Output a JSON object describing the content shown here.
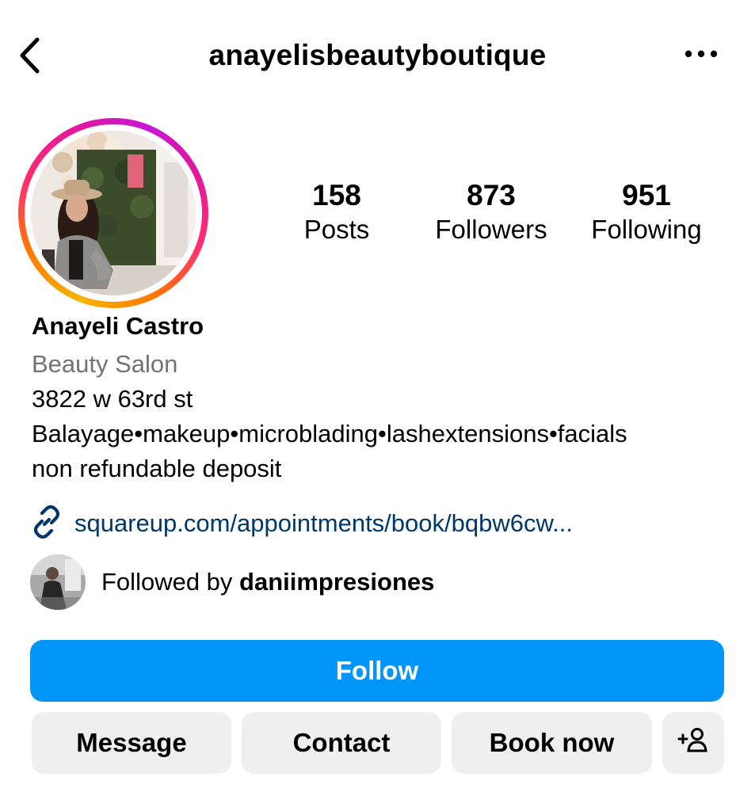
{
  "header": {
    "username": "anayelisbeautyboutique"
  },
  "stats": {
    "posts": {
      "count": "158",
      "label": "Posts"
    },
    "followers": {
      "count": "873",
      "label": "Followers"
    },
    "following": {
      "count": "951",
      "label": "Following"
    }
  },
  "profile": {
    "full_name": "Anayeli Castro",
    "category": "Beauty Salon",
    "bio_lines": [
      "3822 w 63rd st",
      "Balayage•makeup•microblading•lashextensions•facials",
      "non refundable deposit"
    ],
    "link": "squareup.com/appointments/book/bqbw6cw..."
  },
  "followed_by": {
    "prefix": "Followed by ",
    "name": "daniimpresiones"
  },
  "buttons": {
    "follow": "Follow",
    "message": "Message",
    "contact": "Contact",
    "book_now": "Book now"
  },
  "colors": {
    "follow_button": "#0095f6",
    "secondary_button": "#efefef",
    "link": "#00376b",
    "category_text": "#737373"
  },
  "icons": {
    "back": "chevron-left-icon",
    "more": "more-horizontal-icon",
    "link": "link-icon",
    "suggest": "add-person-icon"
  }
}
